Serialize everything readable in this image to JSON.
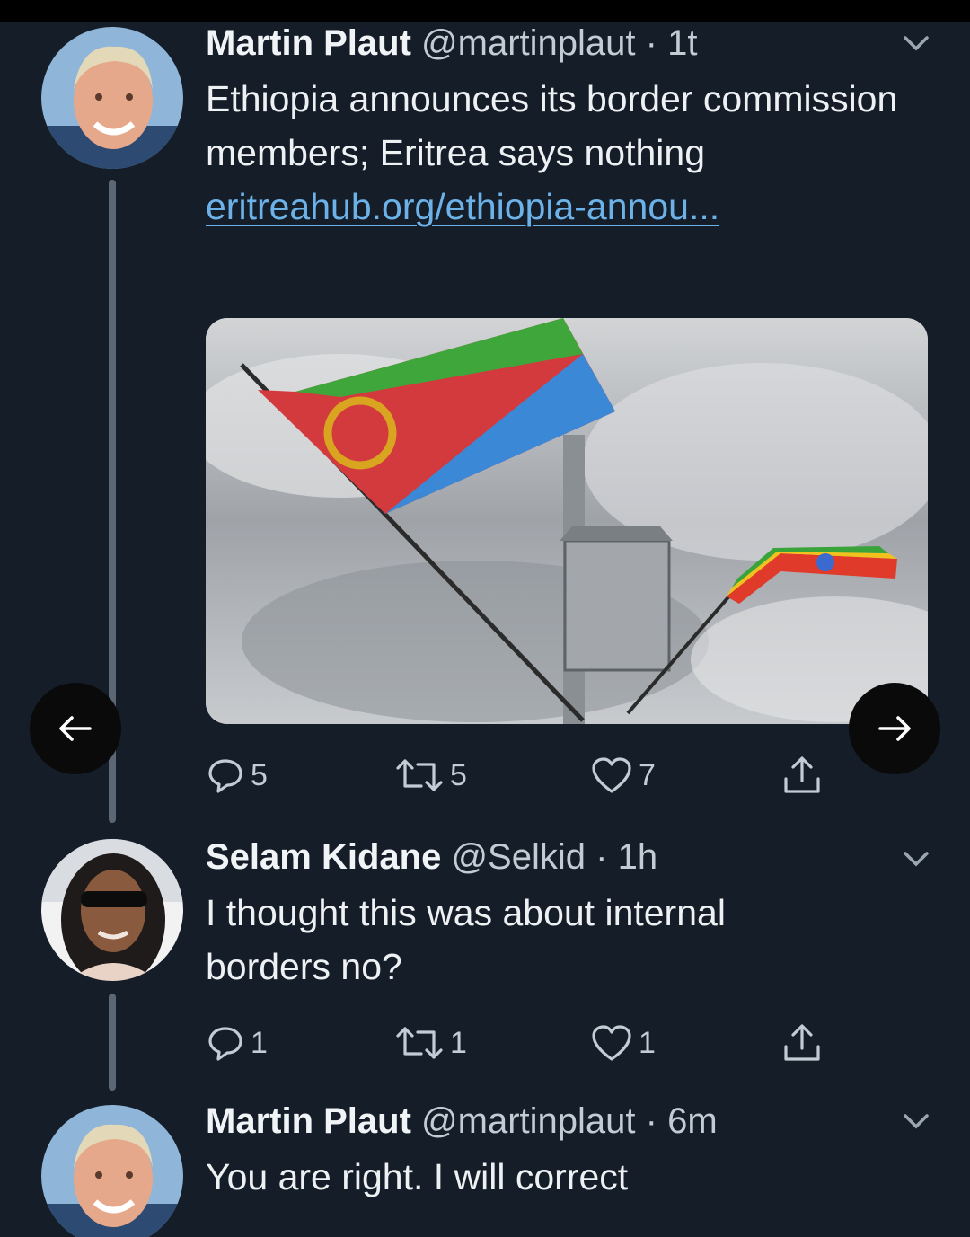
{
  "tweets": [
    {
      "name": "Martin Plaut",
      "handle": "@martinplaut",
      "time": "· 1t",
      "text_before_link": "Ethiopia announces its border commission members; Eritrea says nothing ",
      "link": "eritreahub.org/ethiopia-annou...",
      "replies": "5",
      "retweets": "5",
      "likes": "7"
    },
    {
      "name": "Selam Kidane",
      "handle": "@Selkid",
      "time": "· 1h",
      "text": "I thought this was about internal borders no?",
      "replies": "1",
      "retweets": "1",
      "likes": "1"
    },
    {
      "name": "Martin Plaut",
      "handle": "@martinplaut",
      "time": "· 6m",
      "text": "You are right. I will correct"
    }
  ],
  "icons": {
    "reply": "reply-icon",
    "retweet": "retweet-icon",
    "like": "heart-icon",
    "share": "share-icon",
    "menu": "chevron-down-icon",
    "prev": "arrow-left-icon",
    "next": "arrow-right-icon"
  },
  "colors": {
    "background": "#151d28",
    "link": "#6cb2e8",
    "flag_green": "#3fa03a",
    "flag_red": "#d63a3a",
    "flag_blue": "#3a8ad6",
    "emblem": "#d9a520"
  }
}
